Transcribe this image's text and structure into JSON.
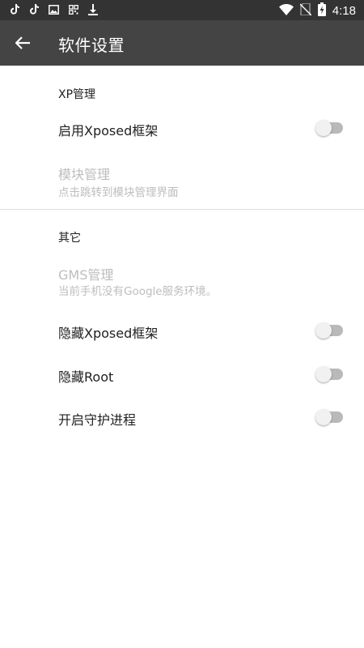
{
  "status_bar": {
    "time": "4:18",
    "left_icons": [
      "tiktok-icon",
      "tiktok-icon",
      "image-icon",
      "qr-icon",
      "download-icon"
    ],
    "right_icons": [
      "wifi-icon",
      "no-sim-icon",
      "battery-charging-icon"
    ]
  },
  "toolbar": {
    "title": "软件设置"
  },
  "sections": {
    "xp": {
      "header": "XP管理",
      "enable_xposed": {
        "title": "启用Xposed框架",
        "checked": false
      },
      "module_manage": {
        "title": "模块管理",
        "summary": "点击跳转到模块管理界面"
      }
    },
    "other": {
      "header": "其它",
      "gms": {
        "title": "GMS管理",
        "summary": "当前手机没有Google服务环境。"
      },
      "hide_xposed": {
        "title": "隐藏Xposed框架",
        "checked": false
      },
      "hide_root": {
        "title": "隐藏Root",
        "checked": false
      },
      "daemon": {
        "title": "开启守护进程",
        "checked": false
      }
    }
  },
  "colors": {
    "status_bar": "#333333",
    "toolbar": "#444444",
    "text_primary": "#212121",
    "text_disabled": "#bdbdbd",
    "switch_track_off": "#b9b9b9",
    "switch_thumb_off": "#f1f1f1"
  }
}
